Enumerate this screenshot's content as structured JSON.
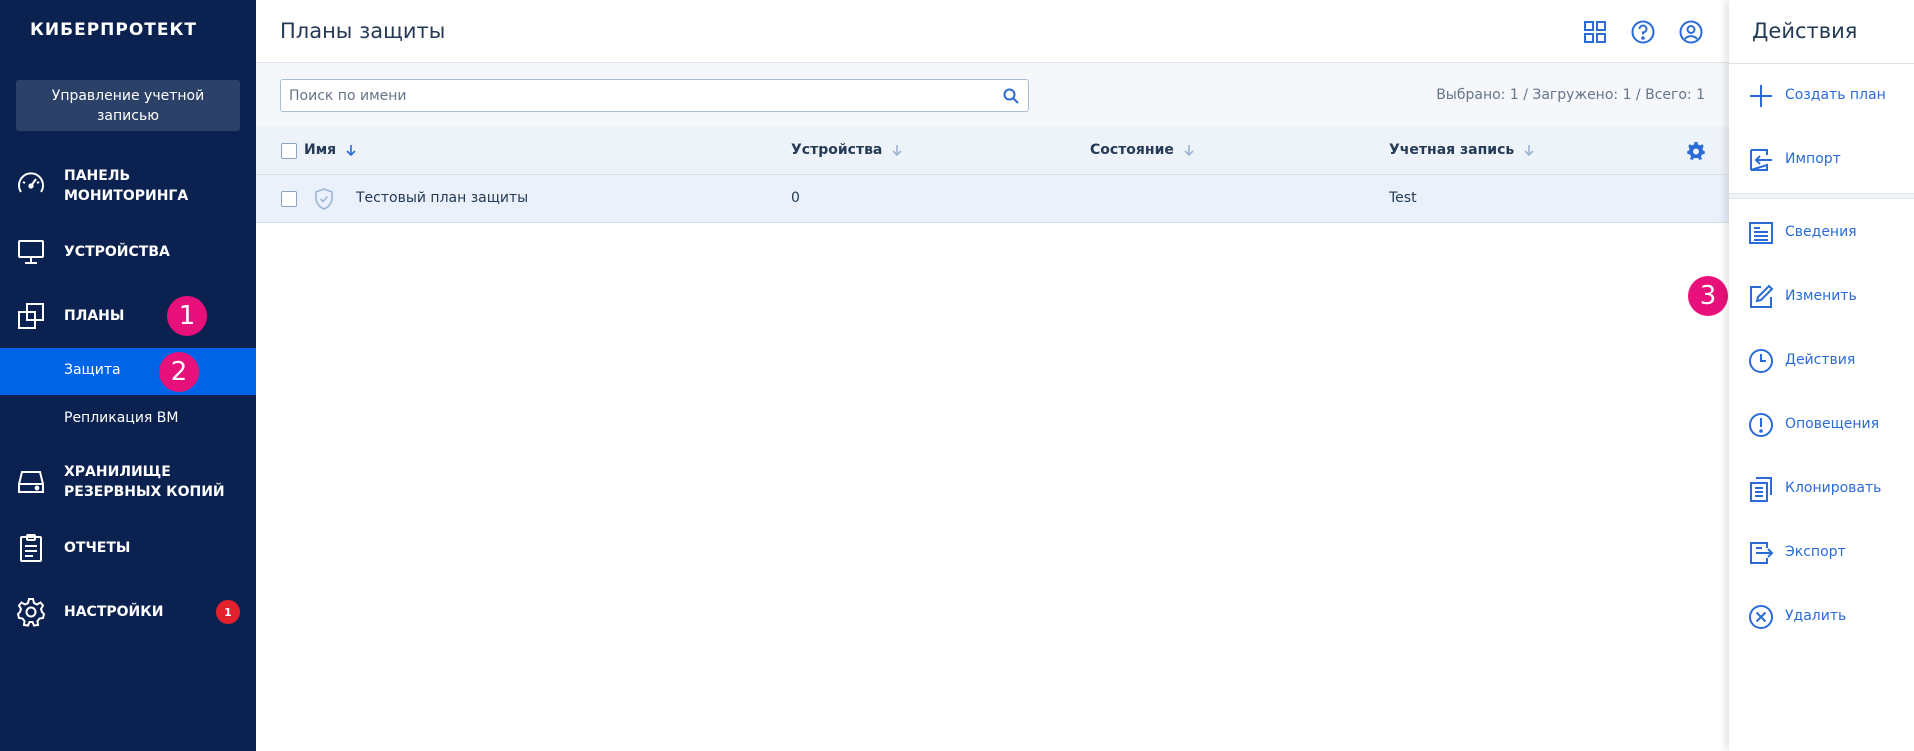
{
  "sidebar": {
    "logo": "КИБЕРПРОТЕКТ",
    "account_button": "Управление учетной записью",
    "nav": {
      "monitoring": {
        "label": "ПАНЕЛЬ МОНИТОРИНГА",
        "icon": "dashboard-gauge-icon"
      },
      "devices": {
        "label": "УСТРОЙСТВА",
        "icon": "monitor-icon"
      },
      "plans": {
        "label": "ПЛАНЫ",
        "icon": "plans-stack-icon"
      },
      "plans_sub": [
        {
          "label": "Защита",
          "active": true
        },
        {
          "label": "Репликация ВМ",
          "active": false
        }
      ],
      "storage": {
        "label": "ХРАНИЛИЩЕ РЕЗЕРВНЫХ КОПИЙ",
        "icon": "storage-drive-icon"
      },
      "reports": {
        "label": "ОТЧЕТЫ",
        "icon": "clipboard-icon"
      },
      "settings": {
        "label": "НАСТРОЙКИ",
        "icon": "gear-icon",
        "badge": "1"
      }
    }
  },
  "markers": {
    "m1": "1",
    "m2": "2",
    "m3": "3"
  },
  "header": {
    "title": "Планы защиты",
    "icons": [
      "apps-grid-icon",
      "help-icon",
      "user-account-icon"
    ]
  },
  "toolbar": {
    "search_placeholder": "Поиск по имени",
    "counter": "Выбрано: 1 / Загружено: 1 / Всего: 1"
  },
  "table": {
    "columns": [
      "Имя",
      "Устройства",
      "Состояние",
      "Учетная запись"
    ],
    "rows": [
      {
        "name": "Тестовый план защиты",
        "devices": "0",
        "status": "",
        "account": "Test"
      }
    ]
  },
  "actions_panel": {
    "title": "Действия",
    "items": [
      {
        "label": "Создать план",
        "icon": "plus-icon"
      },
      {
        "label": "Импорт",
        "icon": "import-icon"
      },
      {
        "label": "Сведения",
        "icon": "details-icon"
      },
      {
        "label": "Изменить",
        "icon": "edit-icon"
      },
      {
        "label": "Действия",
        "icon": "clock-icon"
      },
      {
        "label": "Оповещения",
        "icon": "alert-icon"
      },
      {
        "label": "Клонировать",
        "icon": "clone-icon"
      },
      {
        "label": "Экспорт",
        "icon": "export-icon"
      },
      {
        "label": "Удалить",
        "icon": "delete-icon"
      }
    ]
  },
  "colors": {
    "sidebar_bg": "#0b2150",
    "active_item": "#0064e6",
    "accent_link": "#2a6bd8",
    "marker": "#e8107a",
    "badge_red": "#e4222e"
  }
}
